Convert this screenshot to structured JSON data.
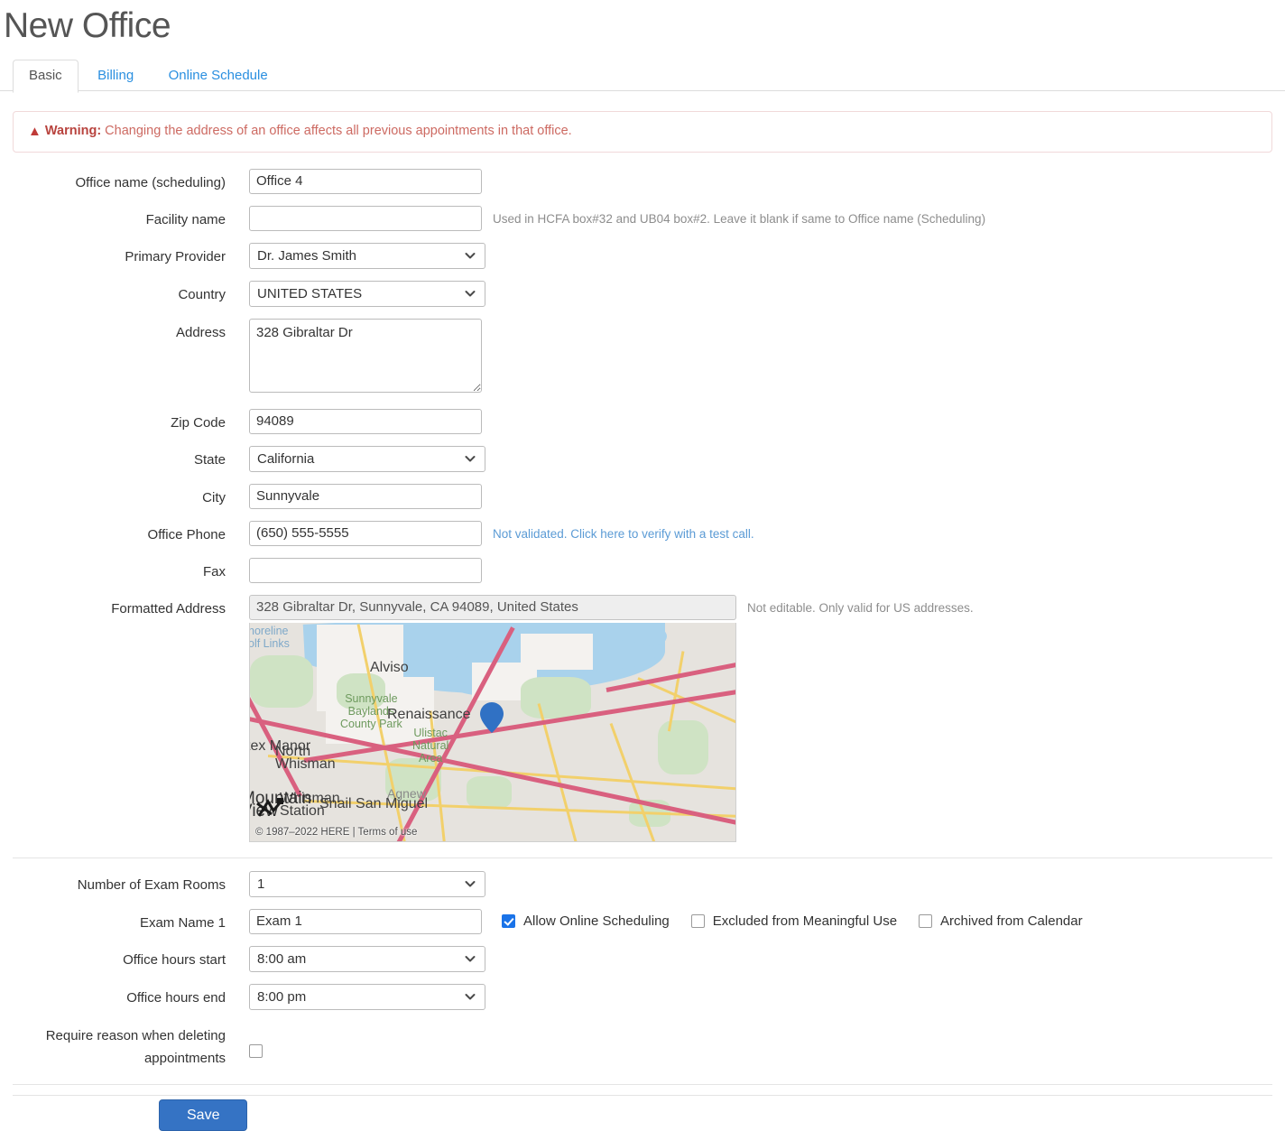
{
  "header": {
    "title": "New Office"
  },
  "tabs": [
    {
      "label": "Basic",
      "active": true
    },
    {
      "label": "Billing",
      "active": false
    },
    {
      "label": "Online Schedule",
      "active": false
    }
  ],
  "warning": {
    "icon": "warning-triangle-icon",
    "label": "Warning:",
    "text": " Changing the address of an office affects all previous appointments in that office."
  },
  "form": {
    "office_name": {
      "label": "Office name (scheduling)",
      "value": "Office 4"
    },
    "facility_name": {
      "label": "Facility name",
      "value": "",
      "hint": "Used in HCFA box#32 and UB04 box#2. Leave it blank if same to Office name (Scheduling)"
    },
    "primary_provider": {
      "label": "Primary Provider",
      "value": "Dr. James Smith"
    },
    "country": {
      "label": "Country",
      "value": "UNITED STATES"
    },
    "address": {
      "label": "Address",
      "value": "328 Gibraltar Dr"
    },
    "zip_code": {
      "label": "Zip Code",
      "value": "94089"
    },
    "state": {
      "label": "State",
      "value": "California"
    },
    "city": {
      "label": "City",
      "value": "Sunnyvale"
    },
    "office_phone": {
      "label": "Office Phone",
      "value": "(650) 555-5555",
      "hint": "Not validated. Click here to verify with a test call."
    },
    "fax": {
      "label": "Fax",
      "value": ""
    },
    "formatted_address": {
      "label": "Formatted Address",
      "value": "328 Gibraltar Dr, Sunnyvale, CA 94089, United States",
      "hint": "Not editable. Only valid for US addresses."
    },
    "number_of_exam_rooms": {
      "label": "Number of Exam Rooms",
      "value": "1"
    },
    "exam_name_1": {
      "label": "Exam Name 1",
      "value": "Exam 1"
    },
    "office_hours_start": {
      "label": "Office hours start",
      "value": "8:00 am"
    },
    "office_hours_end": {
      "label": "Office hours end",
      "value": "8:00 pm"
    },
    "require_reason": {
      "label": "Require reason when deleting appointments",
      "checked": false
    }
  },
  "checkboxes": [
    {
      "label": "Allow Online Scheduling",
      "checked": true
    },
    {
      "label": "Excluded from Meaningful Use",
      "checked": false
    },
    {
      "label": "Archived from Calendar",
      "checked": false
    }
  ],
  "map": {
    "pin": "map-pin-icon",
    "credit": "© 1987–2022 HERE | Terms of use",
    "labels": {
      "shoreline_golf": "horeline\nolf Links",
      "alviso": "Alviso",
      "sunnyvale_park": "Sunnyvale\nBaylands\nCounty Park",
      "renaissance": "Renaissance",
      "ulistac": "Ulistac\nNatural\nArea",
      "agnew": "Agnew",
      "rex_manor": "tex Manor",
      "north_whisman": "North\nWhisman",
      "whisman_station": "Whisman\nStation",
      "snail_san_miguel": "Snail San Miguel",
      "mountain_view": "Mountain\nView"
    }
  },
  "actions": {
    "save": "Save"
  },
  "colors": {
    "link": "#2a8fe0",
    "warning": "#c7544f",
    "primary": "#3573c4",
    "checkbox_checked": "#1a73e8"
  }
}
